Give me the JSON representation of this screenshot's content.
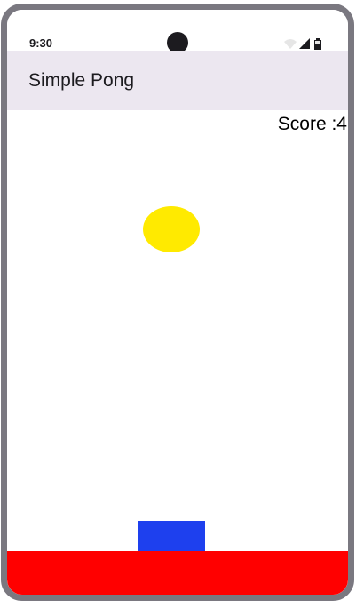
{
  "status_bar": {
    "time": "9:30",
    "icons": [
      "wifi-icon",
      "cellular-signal-icon",
      "battery-icon"
    ]
  },
  "app_bar": {
    "title": "Simple Pong"
  },
  "game": {
    "score_text": "Score :4",
    "colors": {
      "ball": "#ffea00",
      "paddle": "#1e40ee",
      "floor": "#ff0000",
      "app_bar_bg": "#ece7f0",
      "frame": "#7a7880"
    }
  }
}
